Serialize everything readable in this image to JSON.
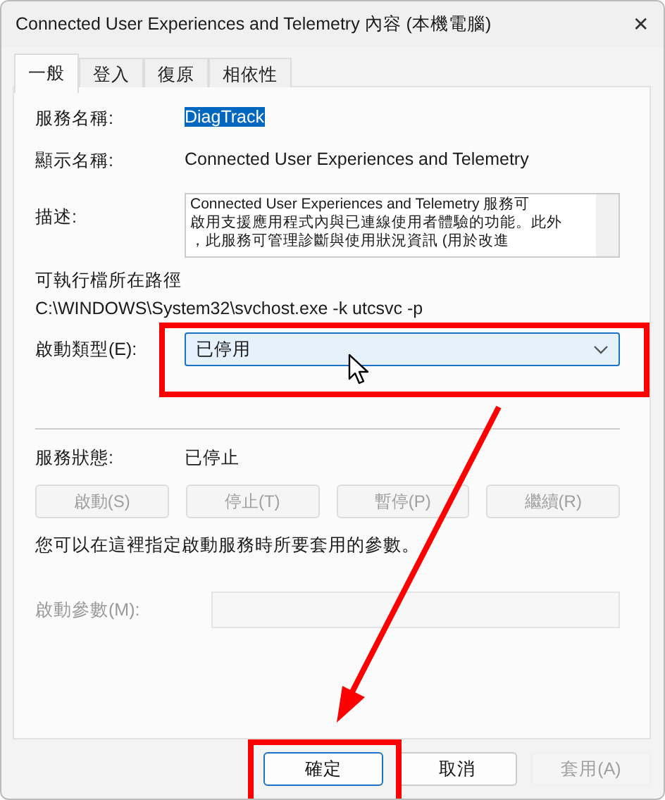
{
  "window": {
    "title": "Connected User Experiences and Telemetry 內容 (本機電腦)",
    "close": "✕"
  },
  "tabs": [
    {
      "label": "一般",
      "selected": true
    },
    {
      "label": "登入",
      "selected": false
    },
    {
      "label": "復原",
      "selected": false
    },
    {
      "label": "相依性",
      "selected": false
    }
  ],
  "general": {
    "service_name": {
      "label": "服務名稱:",
      "value": "DiagTrack",
      "selected": true
    },
    "display_name": {
      "label": "顯示名稱:",
      "value": "Connected User Experiences and Telemetry"
    },
    "description": {
      "label": "描述:",
      "lines": [
        "Connected User Experiences and Telemetry 服務可",
        "啟用支援應用程式內與已連線使用者體驗的功能。此外",
        "，此服務可管理診斷與使用狀況資訊 (用於改進"
      ]
    },
    "path": {
      "label": "可執行檔所在路徑",
      "value": "C:\\WINDOWS\\System32\\svchost.exe -k utcsvc -p"
    },
    "startup_type": {
      "label": "啟動類型(E):",
      "value": "已停用"
    },
    "status": {
      "label": "服務狀態:",
      "value": "已停止"
    },
    "service_buttons": [
      {
        "label": "啟動(S)",
        "disabled": true
      },
      {
        "label": "停止(T)",
        "disabled": true
      },
      {
        "label": "暫停(P)",
        "disabled": true
      },
      {
        "label": "繼續(R)",
        "disabled": true
      }
    ],
    "hint": "您可以在這裡指定啟動服務時所要套用的參數。",
    "parameters": {
      "label": "啟動參數(M):",
      "disabled": true
    }
  },
  "buttons": [
    {
      "label": "確定",
      "default": true,
      "disabled": false
    },
    {
      "label": "取消",
      "default": false,
      "disabled": false
    },
    {
      "label": "套用(A)",
      "default": false,
      "disabled": true
    }
  ]
}
